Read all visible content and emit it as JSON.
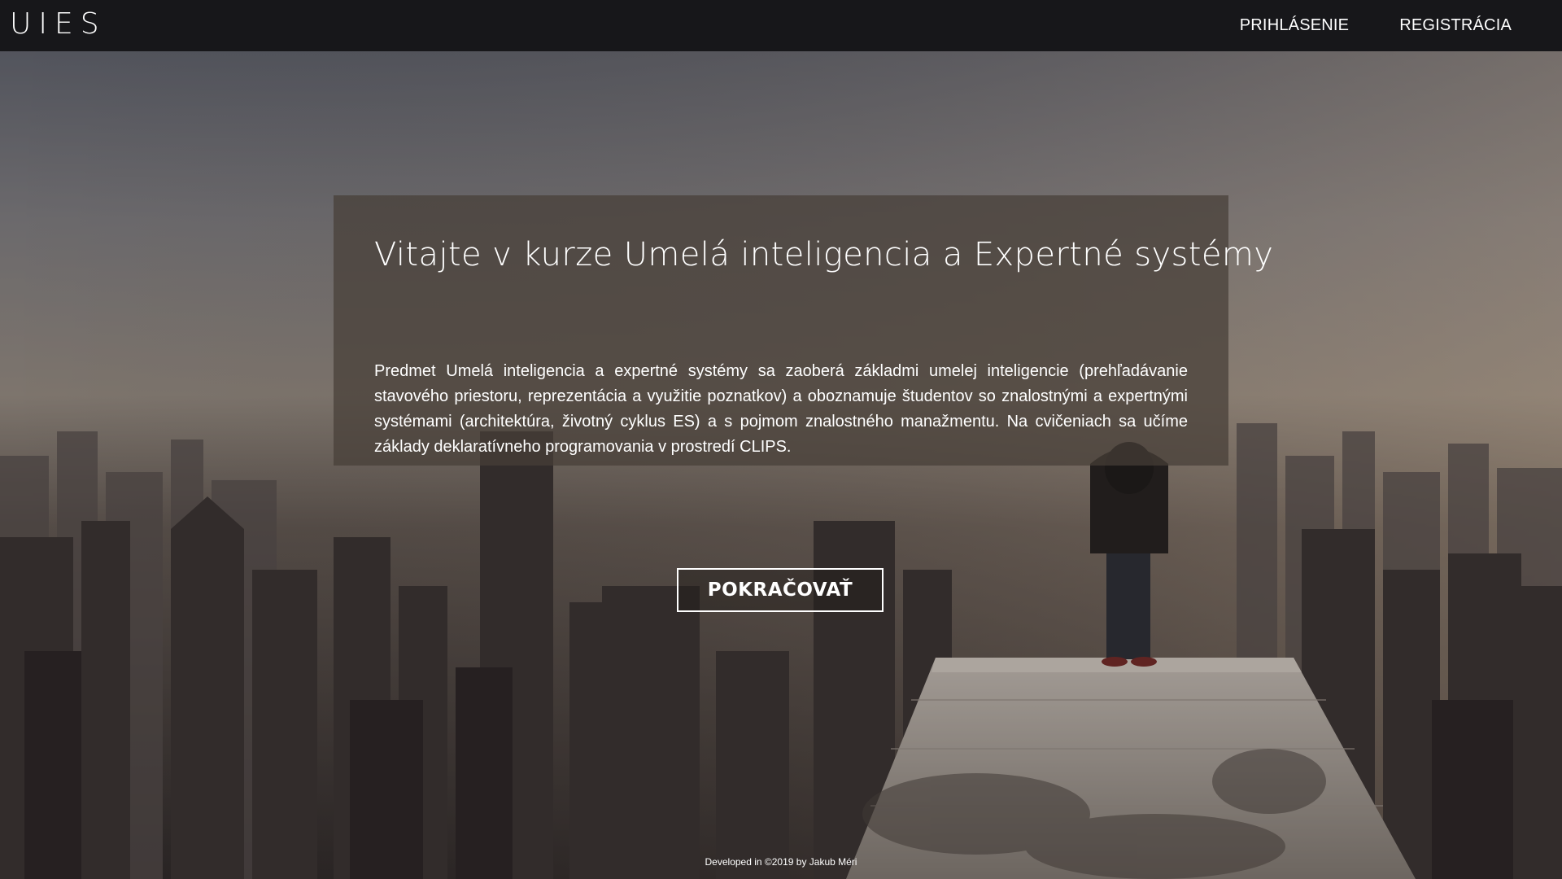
{
  "brand": {
    "logo": "UIES"
  },
  "nav": {
    "login_label": "PRIHLÁSENIE",
    "register_label": "REGISTRÁCIA"
  },
  "hero": {
    "title": "Vitajte v kurze Umelá inteligencia a Expertné systémy",
    "description": "Predmet Umelá inteligencia a expertné systémy sa zaoberá základmi umelej inteligencie (prehľadávanie stavového priestoru, reprezentácia a využitie poznatkov) a oboznamuje študentov so znalostnými a expertnými systémami (architektúra, životný cyklus ES) a s pojmom znalostného manažmentu. Na cvičeniach sa učíme základy deklaratívneho programovania v prostredí CLIPS.",
    "continue_label": "POKRAČOVAŤ"
  },
  "footer": {
    "text": "Developed in ©2019 by Jakub Méri"
  },
  "colors": {
    "navbar": "#17171a",
    "text": "#ffffff",
    "panel": "#463e38"
  }
}
